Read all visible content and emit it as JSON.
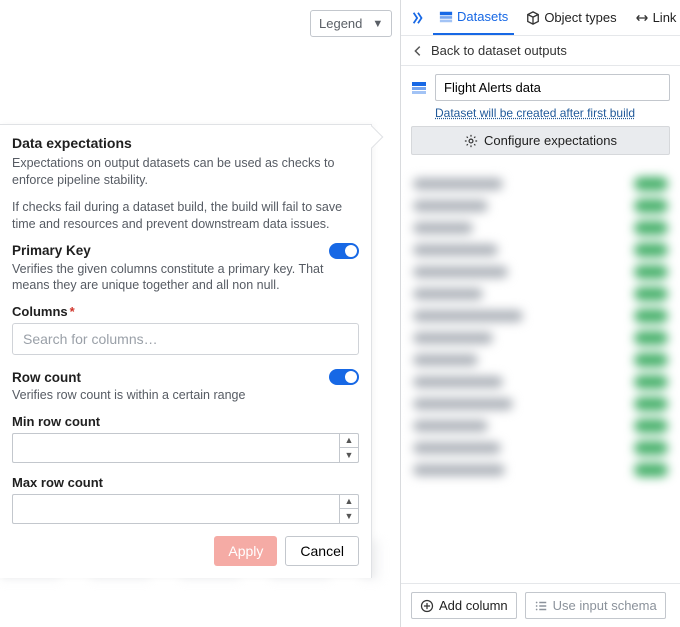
{
  "legend_dropdown": {
    "label": "Legend"
  },
  "right": {
    "tabs": {
      "datasets": "Datasets",
      "object_types": "Object types",
      "link_types": "Link types"
    },
    "back_label": "Back to dataset outputs",
    "dataset_name": "Flight Alerts data",
    "dataset_note": "Dataset will be created after first build",
    "configure_expectations": "Configure expectations",
    "add_column": "Add column",
    "use_input_schema": "Use input schema"
  },
  "left": {
    "title": "Data expectations",
    "desc1": "Expectations on output datasets can be used as checks to enforce pipeline stability.",
    "desc2": "If checks fail during a dataset build, the build will fail to save time and resources and prevent downstream data issues.",
    "primary_key": {
      "label": "Primary Key",
      "desc": "Verifies the given columns constitute a primary key. That means they are unique together and all non null."
    },
    "columns": {
      "label": "Columns",
      "placeholder": "Search for columns…"
    },
    "row_count": {
      "label": "Row count",
      "desc": "Verifies row count is within a certain range"
    },
    "min_row": "Min row count",
    "max_row": "Max row count",
    "apply": "Apply",
    "cancel": "Cancel"
  }
}
